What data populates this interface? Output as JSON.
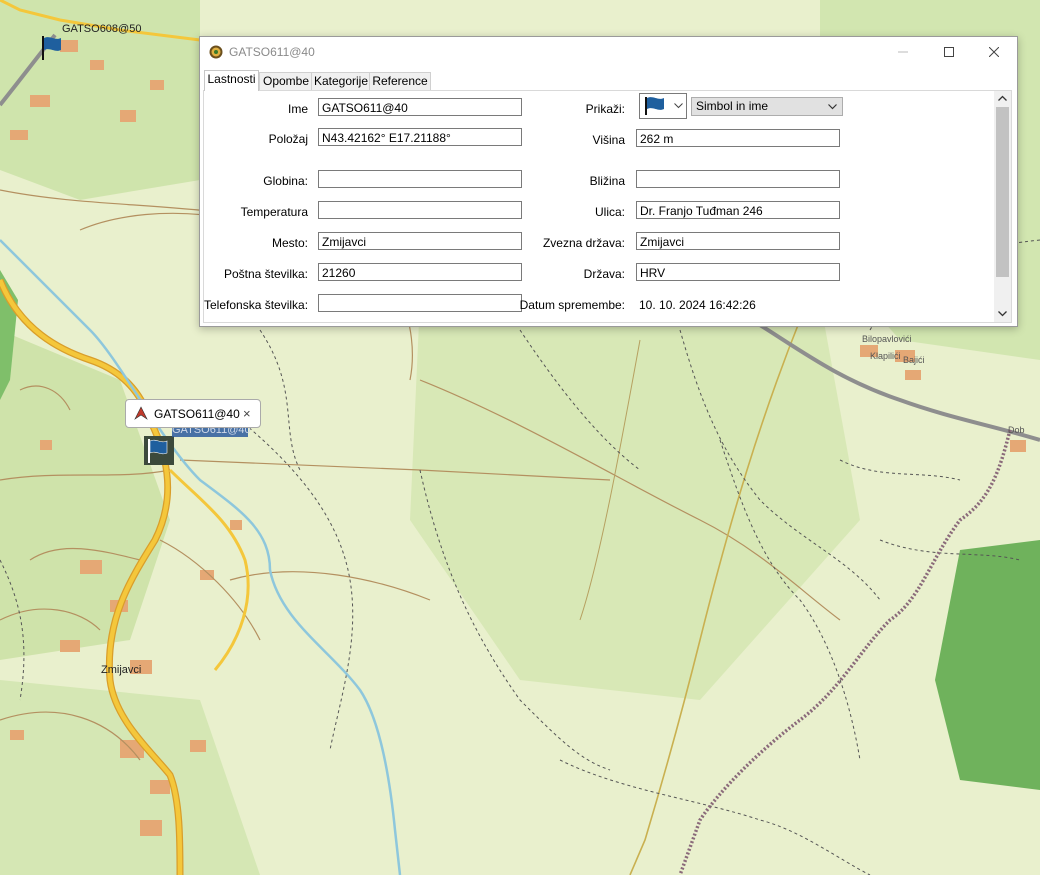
{
  "map": {
    "waypoint_608": "GATSO608@50",
    "waypoint_611_selected": "GATSO611@40",
    "town_zmijavci": "Zmijavci",
    "village_bilopavlovici": "Bilopavlovići",
    "village_klapilici": "Klapilići",
    "village_bajici": "Bajići",
    "road_label_right": "Dob",
    "tooltip_text": "GATSO611@40",
    "tooltip_close": "×"
  },
  "dialog": {
    "title": "GATSO611@40",
    "tabs": [
      "Lastnosti",
      "Opombe",
      "Kategorije",
      "Reference"
    ],
    "left": {
      "ime_label": "Ime",
      "ime_value": "GATSO611@40",
      "polozaj_label": "Položaj",
      "polozaj_value": "N43.42162° E17.21188°",
      "globina_label": "Globina:",
      "globina_value": "",
      "temperatura_label": "Temperatura",
      "temperatura_value": "",
      "mesto_label": "Mesto:",
      "mesto_value": "Zmijavci",
      "postna_label": "Poštna številka:",
      "postna_value": "21260",
      "telefon_label": "Telefonska številka:",
      "telefon_value": ""
    },
    "right": {
      "prikazi_label": "Prikaži:",
      "prikazi_value": "Simbol in ime",
      "visina_label": "Višina",
      "visina_value": "262 m",
      "blizina_label": "Bližina",
      "blizina_value": "",
      "ulica_label": "Ulica:",
      "ulica_value": "Dr. Franjo Tuđman 246",
      "zvezna_label": "Zvezna država:",
      "zvezna_value": "Zmijavci",
      "drzava_label": "Država:",
      "drzava_value": "HRV",
      "datum_label": "Datum spremembe:",
      "datum_value": "10. 10. 2024 16:42:26"
    }
  },
  "colors": {
    "flag_blue": "#1f5f9e",
    "road_yellow": "#f2c230",
    "river_blue": "#86c3d9",
    "forest_green": "#7fbf6a",
    "map_base": "#e8efc9"
  }
}
